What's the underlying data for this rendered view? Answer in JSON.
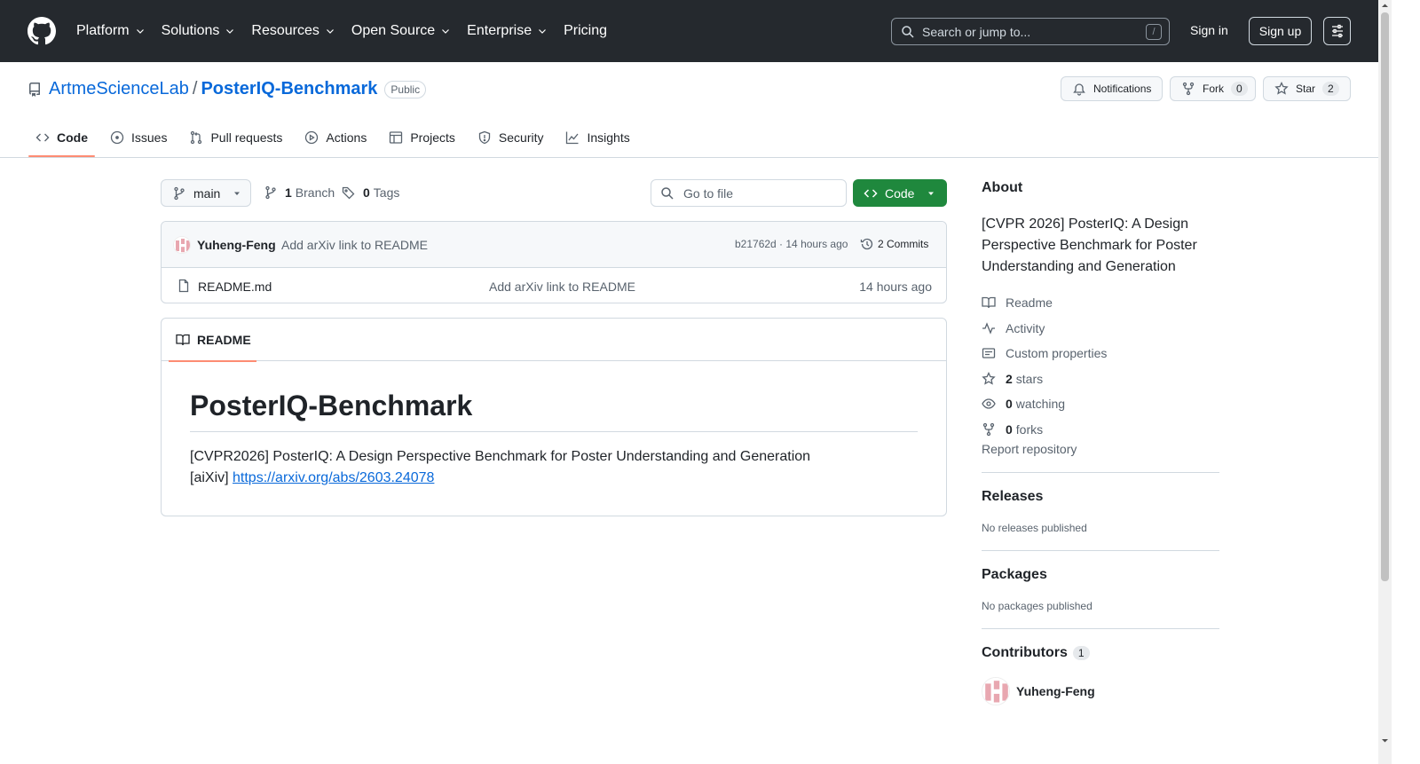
{
  "header": {
    "nav": [
      "Platform",
      "Solutions",
      "Resources",
      "Open Source",
      "Enterprise",
      "Pricing"
    ],
    "search_placeholder": "Search or jump to...",
    "search_shortcut": "/",
    "sign_in": "Sign in",
    "sign_up": "Sign up"
  },
  "repo": {
    "owner": "ArtmeScienceLab",
    "separator": "/",
    "name": "PosterIQ-Benchmark",
    "visibility": "Public",
    "notifications_label": "Notifications",
    "fork_label": "Fork",
    "fork_count": "0",
    "star_label": "Star",
    "star_count": "2"
  },
  "tabs": [
    "Code",
    "Issues",
    "Pull requests",
    "Actions",
    "Projects",
    "Security",
    "Insights"
  ],
  "filenav": {
    "branch": "main",
    "branch_count": "1",
    "branch_label": "Branch",
    "tag_count": "0",
    "tag_label": "Tags",
    "goto_placeholder": "Go to file",
    "code_label": "Code"
  },
  "commit": {
    "author": "Yuheng-Feng",
    "message": "Add arXiv link to README",
    "meta": "b21762d · 14 hours ago",
    "count_label": "2 Commits"
  },
  "files": [
    {
      "name": "README.md",
      "message": "Add arXiv link to README",
      "time": "14 hours ago"
    }
  ],
  "readme": {
    "tab_label": "README",
    "title": "PosterIQ-Benchmark",
    "line1": "[CVPR2026] PosterIQ: A Design Perspective Benchmark for Poster Understanding and Generation",
    "line2_prefix": "[aiXiv] ",
    "link": "https://arxiv.org/abs/2603.24078"
  },
  "sidebar": {
    "about_heading": "About",
    "about_desc": "[CVPR 2026] PosterIQ: A Design Perspective Benchmark for Poster Understanding and Generation",
    "readme": "Readme",
    "activity": "Activity",
    "custom_properties": "Custom properties",
    "stars_count": "2",
    "stars_label": "stars",
    "watching_count": "0",
    "watching_label": "watching",
    "forks_count": "0",
    "forks_label": "forks",
    "report": "Report repository",
    "releases_heading": "Releases",
    "releases_text": "No releases published",
    "packages_heading": "Packages",
    "packages_text": "No packages published",
    "contributors_heading": "Contributors",
    "contributors_count": "1",
    "contributor_name": "Yuheng-Feng"
  },
  "colors": {
    "header_bg": "#25292e",
    "link": "#0969da",
    "code_button": "#1f883d",
    "tab_underline": "#fd8c73"
  }
}
